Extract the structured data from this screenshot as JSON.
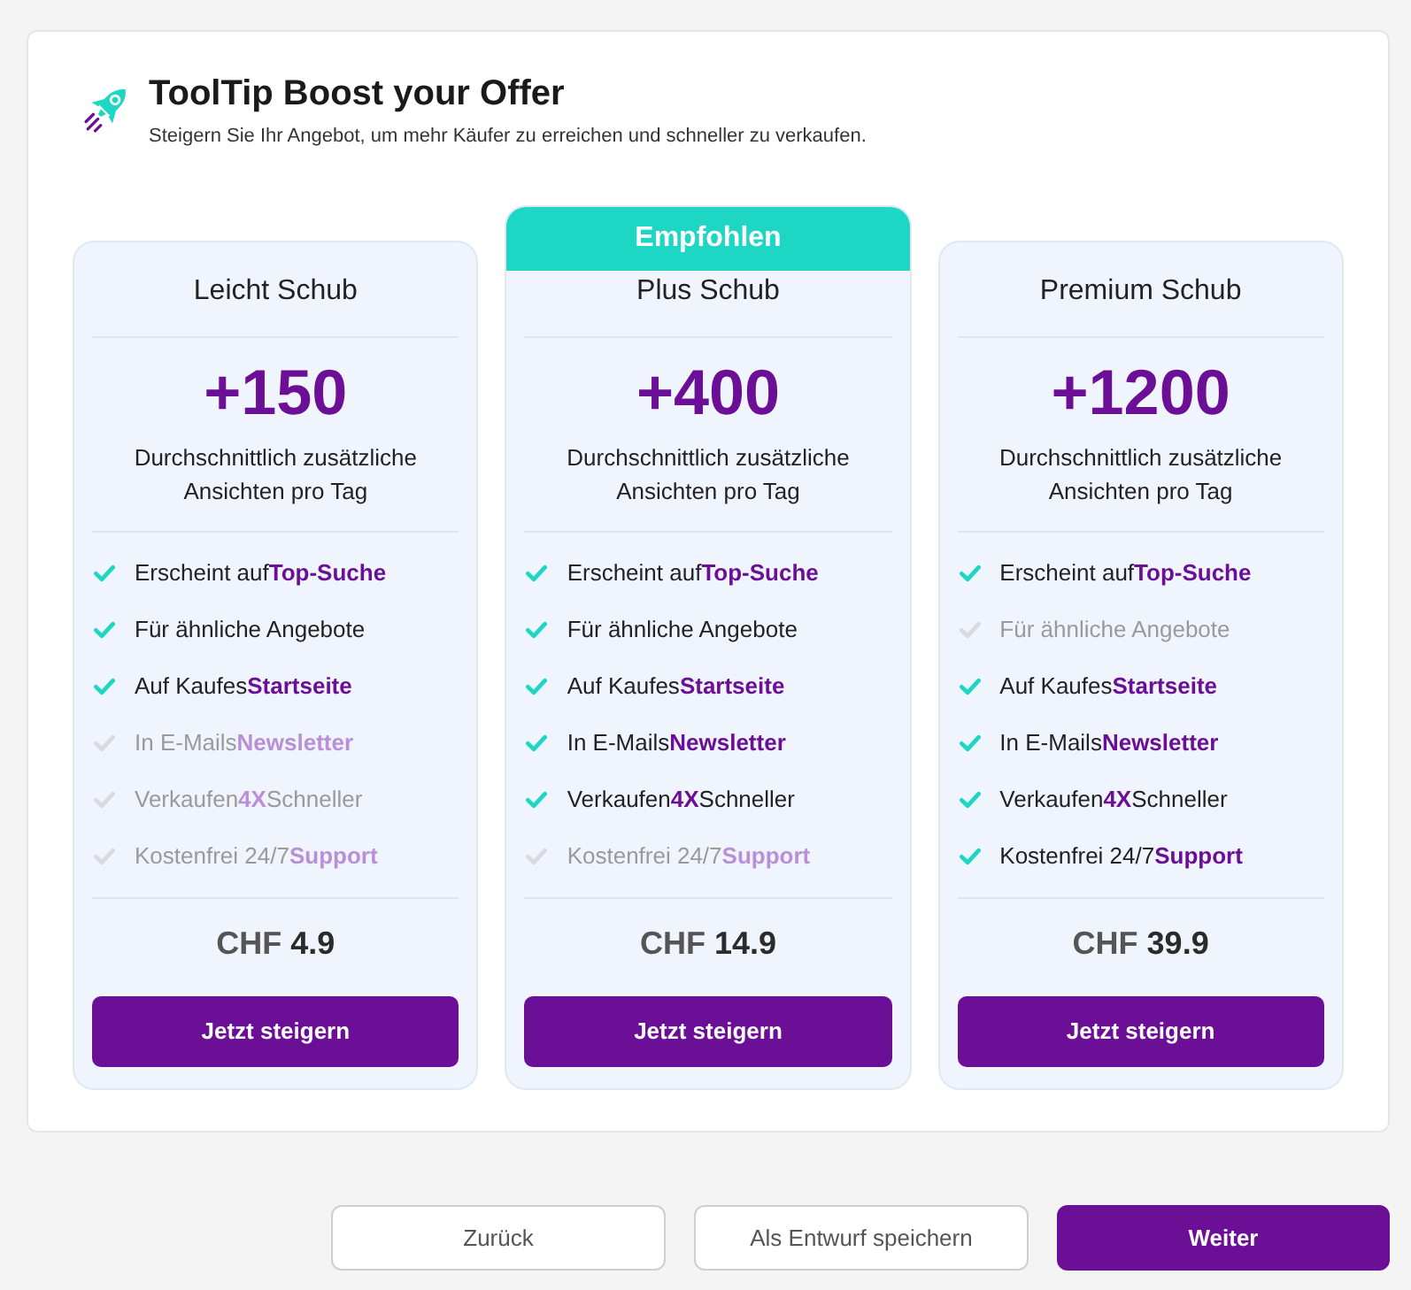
{
  "header": {
    "title": "ToolTip Boost your Offer",
    "subtitle": "Steigern Sie Ihr Angebot, um mehr Käufer zu erreichen und schneller zu verkaufen."
  },
  "plans": [
    {
      "name": "Leicht Schub",
      "views": "+150",
      "views_caption": "Durchschnittlich zusätzliche Ansichten pro Tag",
      "features": [
        {
          "text": "Erscheint auf**Top-Suche**",
          "included": true
        },
        {
          "text": "Für ähnliche Angebote",
          "included": true
        },
        {
          "text": "Auf Kaufes**Startseite**",
          "included": true
        },
        {
          "text": "In E-Mails**Newsletter**",
          "included": false
        },
        {
          "text": "Verkaufen**4X**Schneller",
          "included": false
        },
        {
          "text": "Kostenfrei 24/7**Support**",
          "included": false
        }
      ],
      "price": {
        "currency": "CHF",
        "amount": "4.9"
      },
      "button": "Jetzt steigern"
    },
    {
      "badge": "Empfohlen",
      "name": "Plus Schub",
      "views": "+400",
      "views_caption": "Durchschnittlich zusätzliche Ansichten pro Tag",
      "features": [
        {
          "text": "Erscheint auf**Top-Suche**",
          "included": true
        },
        {
          "text": "Für ähnliche Angebote",
          "included": true
        },
        {
          "text": "Auf Kaufes**Startseite**",
          "included": true
        },
        {
          "text": "In E-Mails**Newsletter**",
          "included": true
        },
        {
          "text": "Verkaufen**4X**Schneller",
          "included": true
        },
        {
          "text": "Kostenfrei 24/7**Support**",
          "included": false
        }
      ],
      "price": {
        "currency": "CHF",
        "amount": "14.9"
      },
      "button": "Jetzt steigern"
    },
    {
      "name": "Premium Schub",
      "views": "+1200",
      "views_caption": "Durchschnittlich zusätzliche Ansichten pro Tag",
      "features": [
        {
          "text": "Erscheint auf**Top-Suche**",
          "included": true
        },
        {
          "text": "Für ähnliche Angebote",
          "included": false
        },
        {
          "text": "Auf Kaufes**Startseite**",
          "included": true
        },
        {
          "text": "In E-Mails**Newsletter**",
          "included": true
        },
        {
          "text": "Verkaufen**4X**Schneller",
          "included": true
        },
        {
          "text": "Kostenfrei 24/7**Support**",
          "included": true
        }
      ],
      "price": {
        "currency": "CHF",
        "amount": "39.9"
      },
      "button": "Jetzt steigern"
    }
  ],
  "footer_buttons": [
    {
      "label": "Zurück",
      "kind": "secondary"
    },
    {
      "label": "Als Entwurf speichern",
      "kind": "secondary"
    },
    {
      "label": "Weiter",
      "kind": "primary"
    }
  ]
}
